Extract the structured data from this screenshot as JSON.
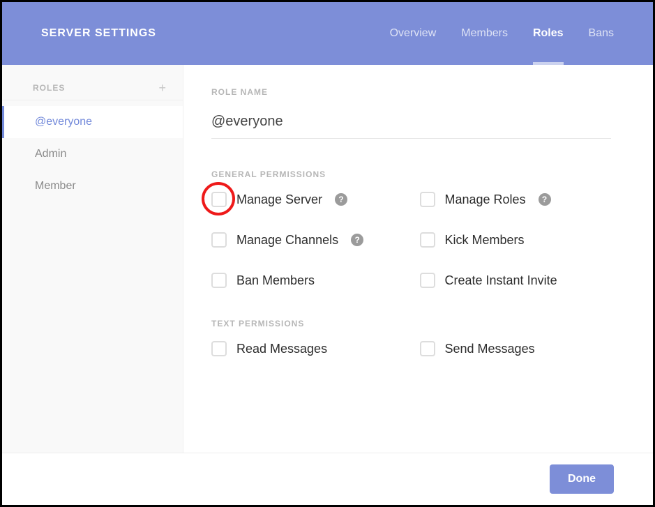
{
  "header": {
    "title": "SERVER SETTINGS",
    "tabs": [
      {
        "label": "Overview",
        "active": false
      },
      {
        "label": "Members",
        "active": false
      },
      {
        "label": "Roles",
        "active": true
      },
      {
        "label": "Bans",
        "active": false
      }
    ]
  },
  "sidebar": {
    "heading": "ROLES",
    "add_icon": "+",
    "items": [
      {
        "label": "@everyone",
        "selected": true
      },
      {
        "label": "Admin",
        "selected": false
      },
      {
        "label": "Member",
        "selected": false
      }
    ]
  },
  "main": {
    "role_name_label": "ROLE NAME",
    "role_name_value": "@everyone",
    "sections": {
      "general": {
        "heading": "GENERAL PERMISSIONS",
        "perms": [
          {
            "label": "Manage Server",
            "checked": false,
            "help": true,
            "highlight": true
          },
          {
            "label": "Manage Roles",
            "checked": false,
            "help": true
          },
          {
            "label": "Manage Channels",
            "checked": false,
            "help": true
          },
          {
            "label": "Kick Members",
            "checked": false,
            "help": false
          },
          {
            "label": "Ban Members",
            "checked": false,
            "help": false
          },
          {
            "label": "Create Instant Invite",
            "checked": false,
            "help": false
          }
        ]
      },
      "text": {
        "heading": "TEXT PERMISSIONS",
        "perms": [
          {
            "label": "Read Messages",
            "checked": false,
            "help": false
          },
          {
            "label": "Send Messages",
            "checked": false,
            "help": false
          }
        ]
      }
    }
  },
  "footer": {
    "done_label": "Done"
  },
  "help_glyph": "?"
}
